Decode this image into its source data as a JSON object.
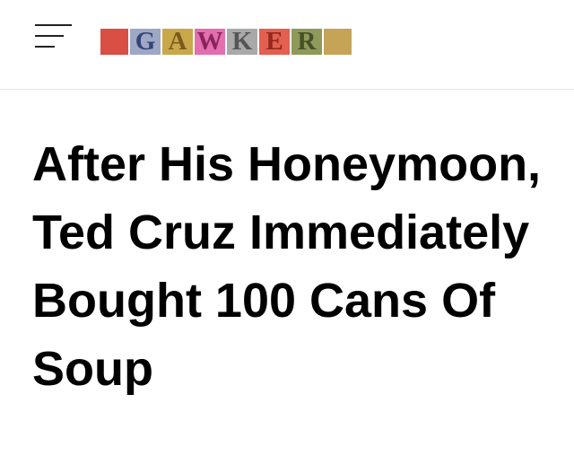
{
  "header": {
    "menu_icon": "hamburger-menu-icon",
    "logo": {
      "text": "GAWKER",
      "tiles": [
        {
          "letter": "",
          "bg": "#d94f43",
          "fg": "#d94f43"
        },
        {
          "letter": "G",
          "bg": "#9ea7c4",
          "fg": "#334477"
        },
        {
          "letter": "A",
          "bg": "#c9a84a",
          "fg": "#7a5a1c"
        },
        {
          "letter": "W",
          "bg": "#e36fae",
          "fg": "#8a2460"
        },
        {
          "letter": "K",
          "bg": "#a9a9a9",
          "fg": "#555555"
        },
        {
          "letter": "E",
          "bg": "#e35f4f",
          "fg": "#93281d"
        },
        {
          "letter": "R",
          "bg": "#8f9a5a",
          "fg": "#46502a"
        },
        {
          "letter": "",
          "bg": "#c5a458",
          "fg": "#c5a458"
        }
      ]
    }
  },
  "article": {
    "headline": "After His Honeymoon, Ted Cruz Immediately Bought 100 Cans Of Soup"
  }
}
